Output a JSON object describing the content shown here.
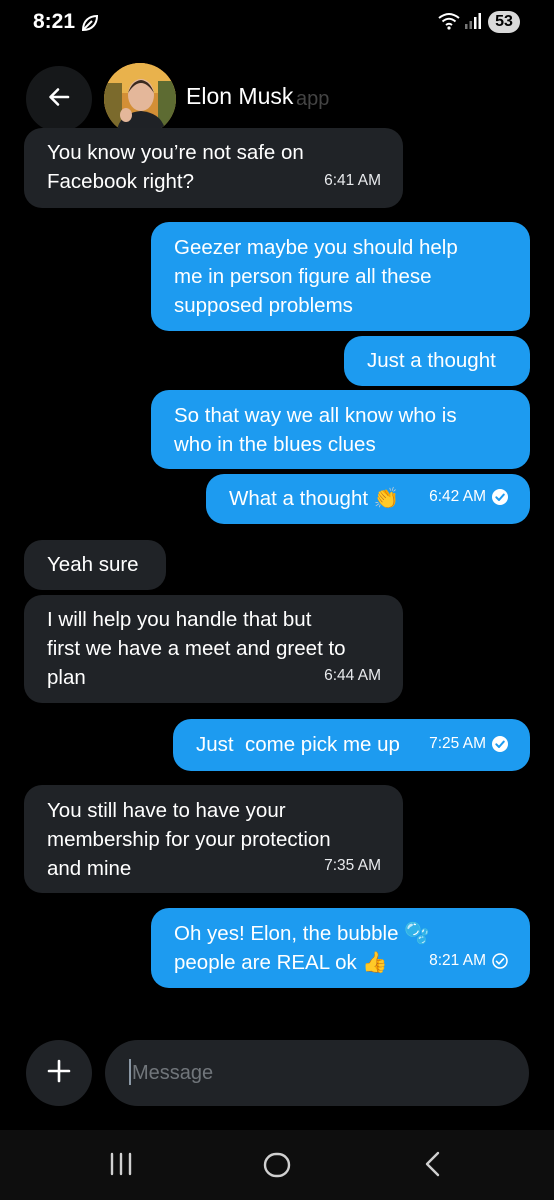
{
  "status_bar": {
    "time": "8:21",
    "battery": "53"
  },
  "header": {
    "contact_name": "Elon Musk",
    "faded_text": "app"
  },
  "messages": [
    {
      "dir": "in",
      "text": "You know you’re not safe on\nFacebook right?",
      "time": "6:41 AM"
    },
    {
      "dir": "out",
      "text": "Geezer maybe you should help\nme in person figure all these\nsupposed problems",
      "time": ""
    },
    {
      "dir": "out",
      "text": "Just a thought",
      "time": ""
    },
    {
      "dir": "out",
      "text": "So that way we all know who is\nwho in the blues clues",
      "time": ""
    },
    {
      "dir": "out",
      "text": "What a thought 👏",
      "time": "6:42 AM",
      "status": "read"
    },
    {
      "dir": "in",
      "text": "Yeah sure",
      "time": ""
    },
    {
      "dir": "in",
      "text": "I will help you handle that but\nfirst we have a meet and greet to\nplan",
      "time": "6:44 AM"
    },
    {
      "dir": "out",
      "text": "Just  come pick me up",
      "time": "7:25 AM",
      "status": "read"
    },
    {
      "dir": "in",
      "text": "You still have to have your\nmembership for your protection\nand mine",
      "time": "7:35 AM"
    },
    {
      "dir": "out",
      "text": "Oh yes! Elon, the bubble 🫧\npeople are REAL ok 👍",
      "time": "8:21 AM",
      "status": "sent"
    }
  ],
  "composer": {
    "placeholder": "Message"
  },
  "icons": {
    "back": "arrow-left-icon",
    "add": "plus-icon",
    "leaf": "leaf-icon",
    "wifi": "wifi-icon",
    "signal": "signal-icon",
    "nav_recents": "recents-icon",
    "nav_home": "home-icon",
    "nav_back": "back-chevron-icon"
  },
  "colors": {
    "background": "#000000",
    "outgoing_bubble": "#1d9bf0",
    "incoming_bubble": "#202327",
    "composer": "#202327"
  }
}
